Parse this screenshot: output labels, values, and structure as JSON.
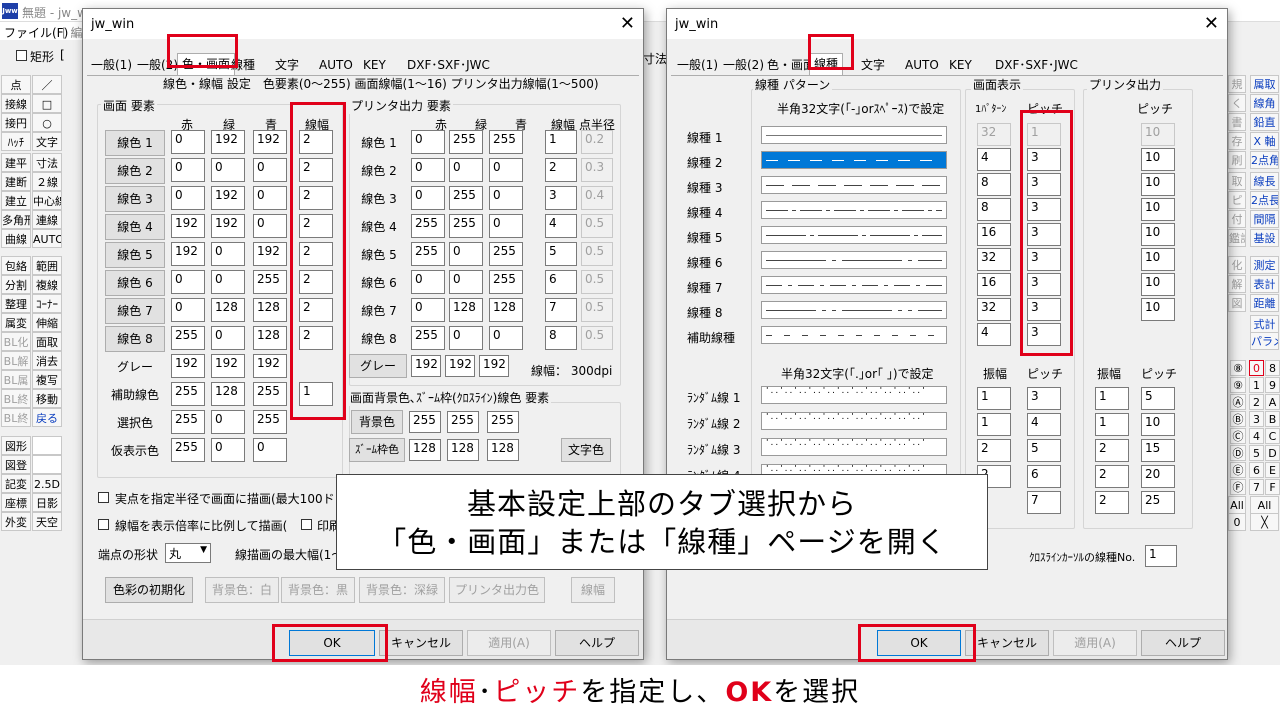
{
  "app": {
    "title": "無題 - jw_w",
    "menu_file": "ファイル(F)",
    "menu_edit": "[ 編",
    "rect_label": "矩形",
    "bracket": "[",
    "right_fragment": "寸法"
  },
  "left_tools": [
    [
      "点",
      "／"
    ],
    [
      "接線",
      "□"
    ],
    [
      "接円",
      "○"
    ],
    [
      "ﾊｯﾁ",
      "文字"
    ],
    [
      "建平",
      "寸法"
    ],
    [
      "建断",
      "２線"
    ],
    [
      "建立",
      "中心線"
    ],
    [
      "多角形",
      "連線"
    ],
    [
      "曲線",
      "AUTO"
    ],
    [
      "包絡",
      "範囲"
    ],
    [
      "分割",
      "複線"
    ],
    [
      "整理",
      "ｺｰﾅｰ"
    ],
    [
      "属変",
      "伸縮"
    ],
    [
      "BL化",
      "面取"
    ],
    [
      "BL解",
      "消去"
    ],
    [
      "BL属",
      "複写"
    ],
    [
      "BL終",
      "移動"
    ],
    [
      "BL終",
      "戻る"
    ],
    [
      "図形",
      ""
    ],
    [
      "図登",
      ""
    ],
    [
      "記変",
      "2.5D"
    ],
    [
      "座標",
      "日影"
    ],
    [
      "外変",
      "天空"
    ]
  ],
  "right_tools": [
    [
      "規",
      "属取"
    ],
    [
      "く",
      "線角"
    ],
    [
      "書",
      "鉛直"
    ],
    [
      "存",
      "X 軸"
    ],
    [
      "刷",
      "2点角"
    ],
    [
      "取",
      "線長"
    ],
    [
      "ピ",
      "2点長"
    ],
    [
      "付",
      "間隔"
    ],
    [
      "鑑計",
      "基設"
    ],
    [
      "化",
      "測定"
    ],
    [
      "解",
      "表計"
    ],
    [
      "図",
      "距離"
    ],
    [
      "",
      "式計"
    ],
    [
      "",
      "パラメ"
    ]
  ],
  "right_nums": [
    [
      "⑧",
      "0",
      "8"
    ],
    [
      "⑨",
      "1",
      "9"
    ],
    [
      "Ⓐ",
      "2",
      "A"
    ],
    [
      "Ⓑ",
      "3",
      "B"
    ],
    [
      "Ⓒ",
      "4",
      "C"
    ],
    [
      "Ⓓ",
      "5",
      "D"
    ],
    [
      "Ⓔ",
      "6",
      "E"
    ],
    [
      "Ⓕ",
      "7",
      "F"
    ]
  ],
  "right_bottom": {
    "all1": "All",
    "all2": "All",
    "zero": "0",
    "x": "╳"
  },
  "dlg1": {
    "title": "jw_win",
    "close": "✕",
    "tabs": [
      "一般(1)",
      "一般(2)",
      "色・画面",
      "線種",
      "文字",
      "AUTO",
      "KEY",
      "DXF･SXF･JWC"
    ],
    "header": "線色・線幅 設定　色要素(0〜255)  画面線幅(1〜16)  プリンタ出力線幅(1〜500)",
    "screen_group": "画面 要素",
    "printer_group": "プリンタ出力 要素",
    "col_r": "赤",
    "col_g": "緑",
    "col_b": "青",
    "col_w": "線幅",
    "col_w2": "線幅",
    "col_pr": "点半径",
    "screen_rows": [
      {
        "label": "線色 1",
        "r": "0",
        "g": "192",
        "b": "192",
        "w": "2"
      },
      {
        "label": "線色 2",
        "r": "0",
        "g": "0",
        "b": "0",
        "w": "2"
      },
      {
        "label": "線色 3",
        "r": "0",
        "g": "192",
        "b": "0",
        "w": "2"
      },
      {
        "label": "線色 4",
        "r": "192",
        "g": "192",
        "b": "0",
        "w": "2"
      },
      {
        "label": "線色 5",
        "r": "192",
        "g": "0",
        "b": "192",
        "w": "2"
      },
      {
        "label": "線色 6",
        "r": "0",
        "g": "0",
        "b": "255",
        "w": "2"
      },
      {
        "label": "線色 7",
        "r": "0",
        "g": "128",
        "b": "128",
        "w": "2"
      },
      {
        "label": "線色 8",
        "r": "255",
        "g": "0",
        "b": "128",
        "w": "2"
      },
      {
        "label": "グレー",
        "r": "192",
        "g": "192",
        "b": "192",
        "w": ""
      },
      {
        "label": "補助線色",
        "r": "255",
        "g": "128",
        "b": "255",
        "w": "1"
      },
      {
        "label": "選択色",
        "r": "255",
        "g": "0",
        "b": "255",
        "w": ""
      },
      {
        "label": "仮表示色",
        "r": "255",
        "g": "0",
        "b": "0",
        "w": ""
      }
    ],
    "printer_rows": [
      {
        "label": "線色 1",
        "r": "0",
        "g": "255",
        "b": "255",
        "w": "1",
        "p": "0.2"
      },
      {
        "label": "線色 2",
        "r": "0",
        "g": "0",
        "b": "0",
        "w": "2",
        "p": "0.3"
      },
      {
        "label": "線色 3",
        "r": "0",
        "g": "255",
        "b": "0",
        "w": "3",
        "p": "0.4"
      },
      {
        "label": "線色 4",
        "r": "255",
        "g": "255",
        "b": "0",
        "w": "4",
        "p": "0.5"
      },
      {
        "label": "線色 5",
        "r": "255",
        "g": "0",
        "b": "255",
        "w": "5",
        "p": "0.5"
      },
      {
        "label": "線色 6",
        "r": "0",
        "g": "0",
        "b": "255",
        "w": "6",
        "p": "0.5"
      },
      {
        "label": "線色 7",
        "r": "0",
        "g": "128",
        "b": "128",
        "w": "7",
        "p": "0.5"
      },
      {
        "label": "線色 8",
        "r": "255",
        "g": "0",
        "b": "0",
        "w": "8",
        "p": "0.5"
      }
    ],
    "printer_gray": {
      "label": "グレー",
      "r": "192",
      "g": "192",
      "b": "192"
    },
    "dpi": "線幅： 300dpi",
    "bg_group": "画面背景色､ｽﾞｰﾑ枠(ｸﾛｽﾗｲﾝ)線色 要素",
    "bg_row": {
      "label": "背景色",
      "r": "255",
      "g": "255",
      "b": "255"
    },
    "zoom_row": {
      "label": "ｽﾞｰﾑ枠色",
      "r": "128",
      "g": "128",
      "b": "128"
    },
    "text_color_btn": "文字色",
    "check1": "実点を指定半径で画面に描画(最大100ドット)",
    "check2": "線幅を表示倍率に比例して描画(",
    "check3": "印刷",
    "endpoint_label": "端点の形状",
    "endpoint_value": "丸",
    "maxwidth_label": "線描画の最大幅(1〜",
    "btn_init": "色彩の初期化",
    "btn_bg_white": "背景色：白",
    "btn_bg_black": "背景色：黒",
    "btn_bg_navy": "背景色：深緑",
    "btn_print_color": "プリンタ出力色",
    "btn_width": "線幅",
    "ok": "OK",
    "cancel": "キャンセル",
    "apply": "適用(A)",
    "help": "ヘルプ"
  },
  "dlg2": {
    "title": "jw_win",
    "close": "✕",
    "tabs": [
      "一般(1)",
      "一般(2)",
      "色・画面",
      "線種",
      "文字",
      "AUTO",
      "KEY",
      "DXF･SXF･JWC"
    ],
    "pattern_group": "線種 パターン",
    "screen_group": "画面表示",
    "printer_group": "プリンタ出力",
    "pattern_sub": "半角32文字(｢-｣orｽﾍﾟｰｽ)で設定",
    "col_1pattern": "1ﾊﾟﾀｰﾝ",
    "col_pitch": "ピッチ",
    "col_pitch_p": "ピッチ",
    "rows": [
      {
        "label": "線種 1",
        "p1": "32",
        "pitch": "1",
        "pp": "10"
      },
      {
        "label": "線種 2",
        "p1": "4",
        "pitch": "3",
        "pp": "10"
      },
      {
        "label": "線種 3",
        "p1": "8",
        "pitch": "3",
        "pp": "10"
      },
      {
        "label": "線種 4",
        "p1": "8",
        "pitch": "3",
        "pp": "10"
      },
      {
        "label": "線種 5",
        "p1": "16",
        "pitch": "3",
        "pp": "10"
      },
      {
        "label": "線種 6",
        "p1": "32",
        "pitch": "3",
        "pp": "10"
      },
      {
        "label": "線種 7",
        "p1": "16",
        "pitch": "3",
        "pp": "10"
      },
      {
        "label": "線種 8",
        "p1": "32",
        "pitch": "3",
        "pp": "10"
      },
      {
        "label": "補助線種",
        "p1": "4",
        "pitch": "3",
        "pp": ""
      }
    ],
    "random_sub": "半角32文字(｢.｣or｢ ｣)で設定",
    "col_amp": "振幅",
    "col_pitch2": "ピッチ",
    "col_amp_p": "振幅",
    "col_pitch2_p": "ピッチ",
    "random_rows": [
      {
        "label": "ﾗﾝﾀﾞﾑ線 1",
        "a": "1",
        "p": "3",
        "ap": "1",
        "pp": "5"
      },
      {
        "label": "ﾗﾝﾀﾞﾑ線 2",
        "a": "1",
        "p": "4",
        "ap": "1",
        "pp": "10"
      },
      {
        "label": "ﾗﾝﾀﾞﾑ線 3",
        "a": "2",
        "p": "5",
        "ap": "2",
        "pp": "15"
      },
      {
        "label": "ﾗﾝﾀﾞﾑ線 4",
        "a": "2",
        "p": "6",
        "ap": "2",
        "pp": "20"
      },
      {
        "label": "",
        "a": "",
        "p": "7",
        "ap": "2",
        "pp": "25"
      }
    ],
    "crossline_label": "ｸﾛｽﾗｲﾝｶｰｿﾙの線種No.",
    "crossline_value": "1",
    "ok": "OK",
    "cancel": "キャンセル",
    "apply": "適用(A)",
    "help": "ヘルプ"
  },
  "overlay": {
    "line1": "基本設定上部のタブ選択から",
    "line2": "「色・画面」または「線種」ページを開く"
  },
  "caption": {
    "part1": "線幅",
    "dot": "･",
    "part2": "ピッチ",
    "part3": "を指定し、",
    "part4": "OK",
    "part5": "を選択"
  },
  "colors": {
    "highlight_red": "#e0001a",
    "selection_blue": "#0078d7",
    "tool_blue": "#0a3dbf"
  }
}
